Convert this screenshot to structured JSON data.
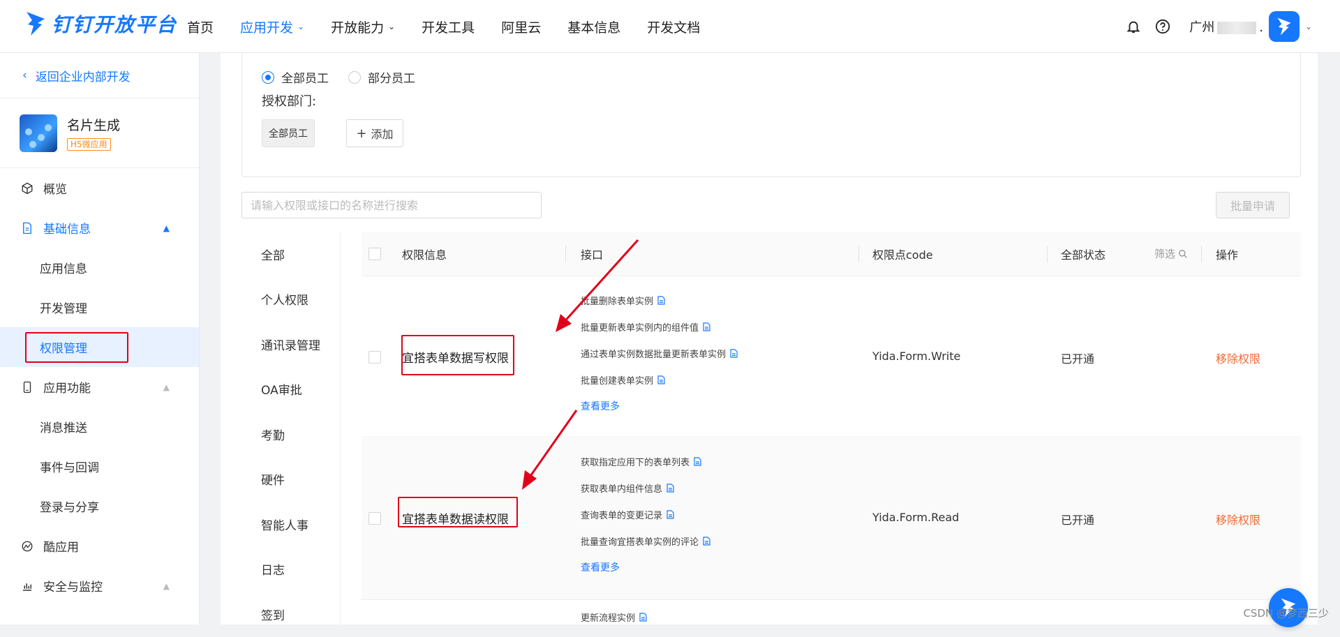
{
  "header": {
    "logo_text": "钉钉开放平台",
    "nav": [
      {
        "label": "首页",
        "active": false,
        "has_dropdown": false
      },
      {
        "label": "应用开发",
        "active": true,
        "has_dropdown": true
      },
      {
        "label": "开放能力",
        "active": false,
        "has_dropdown": true
      },
      {
        "label": "开发工具",
        "active": false,
        "has_dropdown": false
      },
      {
        "label": "阿里云",
        "active": false,
        "has_dropdown": false
      },
      {
        "label": "基本信息",
        "active": false,
        "has_dropdown": false
      },
      {
        "label": "开发文档",
        "active": false,
        "has_dropdown": false
      }
    ],
    "user_name_prefix": "广州",
    "user_name_suffix": "."
  },
  "sidebar": {
    "back_label": "返回企业内部开发",
    "app_name": "名片生成",
    "app_tag": "H5微应用",
    "items": [
      {
        "label": "概览",
        "icon": "cube-icon",
        "type": "menu"
      },
      {
        "label": "基础信息",
        "icon": "doc-icon",
        "type": "menu",
        "expanded": true
      },
      {
        "label": "应用信息",
        "type": "sub"
      },
      {
        "label": "开发管理",
        "type": "sub"
      },
      {
        "label": "权限管理",
        "type": "sub",
        "active": true
      },
      {
        "label": "应用功能",
        "icon": "phone-icon",
        "type": "menu",
        "expanded": false
      },
      {
        "label": "消息推送",
        "type": "sub"
      },
      {
        "label": "事件与回调",
        "type": "sub"
      },
      {
        "label": "登录与分享",
        "type": "sub"
      },
      {
        "label": "酷应用",
        "icon": "cool-app-icon",
        "type": "menu"
      },
      {
        "label": "安全与监控",
        "icon": "chart-icon",
        "type": "menu",
        "expanded": false
      }
    ]
  },
  "scope": {
    "radio_all": "全部员工",
    "radio_part": "部分员工",
    "auth_label": "授权部门:",
    "dept_tag": "全部员工",
    "add_label": "添加"
  },
  "search": {
    "placeholder": "请输入权限或接口的名称进行搜索"
  },
  "batch_button": "批量申请",
  "categories": [
    "全部",
    "个人权限",
    "通讯录管理",
    "OA审批",
    "考勤",
    "硬件",
    "智能人事",
    "日志",
    "签到"
  ],
  "table": {
    "headers": {
      "perm": "权限信息",
      "api": "接口",
      "code": "权限点code",
      "status": "全部状态",
      "filter": "筛选",
      "action": "操作"
    },
    "rows": [
      {
        "perm": "宜搭表单数据写权限",
        "apis": [
          "批量删除表单实例",
          "批量更新表单实例内的组件值",
          "通过表单实例数据批量更新表单实例",
          "批量创建表单实例"
        ],
        "more": "查看更多",
        "code": "Yida.Form.Write",
        "status": "已开通",
        "action": "移除权限"
      },
      {
        "perm": "宜搭表单数据读权限",
        "apis": [
          "获取指定应用下的表单列表",
          "获取表单内组件信息",
          "查询表单的变更记录",
          "批量查询宜搭表单实例的评论"
        ],
        "more": "查看更多",
        "code": "Yida.Form.Read",
        "status": "已开通",
        "action": "移除权限"
      },
      {
        "apis": [
          "更新流程实例"
        ]
      }
    ]
  },
  "watermark": "CSDN @梦西三少",
  "colors": {
    "primary": "#1677ff",
    "danger": "#f06a35",
    "annotation": "#e0001a"
  }
}
